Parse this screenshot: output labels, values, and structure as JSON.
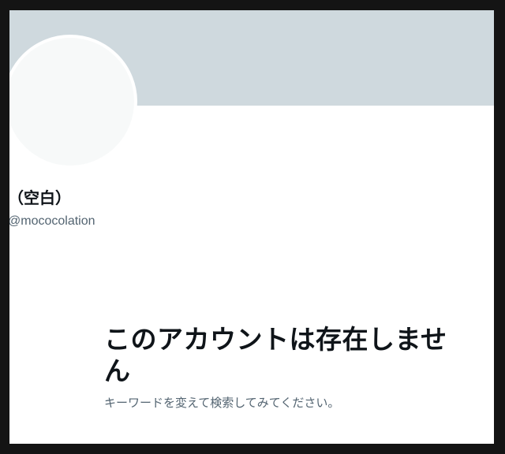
{
  "profile": {
    "display_name": "（空白）",
    "handle": "@mococolation"
  },
  "empty_state": {
    "title": "このアカウントは存在しません",
    "subtitle": "キーワードを変えて検索してみてください。"
  },
  "colors": {
    "banner": "#cfd9de",
    "avatar": "#f7f9f9",
    "primary_text": "#0f1419",
    "secondary_text": "#536471",
    "page_border": "#141414"
  }
}
